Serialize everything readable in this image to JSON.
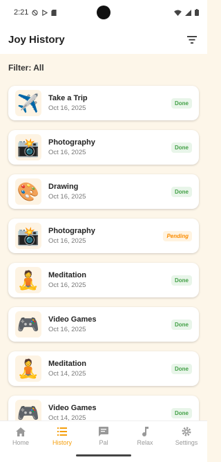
{
  "status": {
    "time": "2:21"
  },
  "header": {
    "title": "Joy History"
  },
  "filter": {
    "label": "Filter: All"
  },
  "entries": [
    {
      "emoji": "✈️",
      "title": "Take a Trip",
      "date": "Oct 16, 2025",
      "status": "Done"
    },
    {
      "emoji": "📸",
      "title": "Photography",
      "date": "Oct 16, 2025",
      "status": "Done"
    },
    {
      "emoji": "🎨",
      "title": "Drawing",
      "date": "Oct 16, 2025",
      "status": "Done"
    },
    {
      "emoji": "📸",
      "title": "Photography",
      "date": "Oct 16, 2025",
      "status": "Pending"
    },
    {
      "emoji": "🧘",
      "title": "Meditation",
      "date": "Oct 16, 2025",
      "status": "Done"
    },
    {
      "emoji": "🎮",
      "title": "Video Games",
      "date": "Oct 16, 2025",
      "status": "Done"
    },
    {
      "emoji": "🧘",
      "title": "Meditation",
      "date": "Oct 14, 2025",
      "status": "Done"
    },
    {
      "emoji": "🎮",
      "title": "Video Games",
      "date": "Oct 14, 2025",
      "status": "Done"
    }
  ],
  "nav": [
    {
      "label": "Home",
      "icon": "home-icon"
    },
    {
      "label": "History",
      "icon": "list-icon"
    },
    {
      "label": "Pal",
      "icon": "chat-icon"
    },
    {
      "label": "Relax",
      "icon": "music-note-icon"
    },
    {
      "label": "Settings",
      "icon": "gear-icon"
    }
  ],
  "colors": {
    "accent": "#f59e0b",
    "done": "#43a047",
    "pending": "#fb8c00",
    "background": "#fdf6e9"
  }
}
